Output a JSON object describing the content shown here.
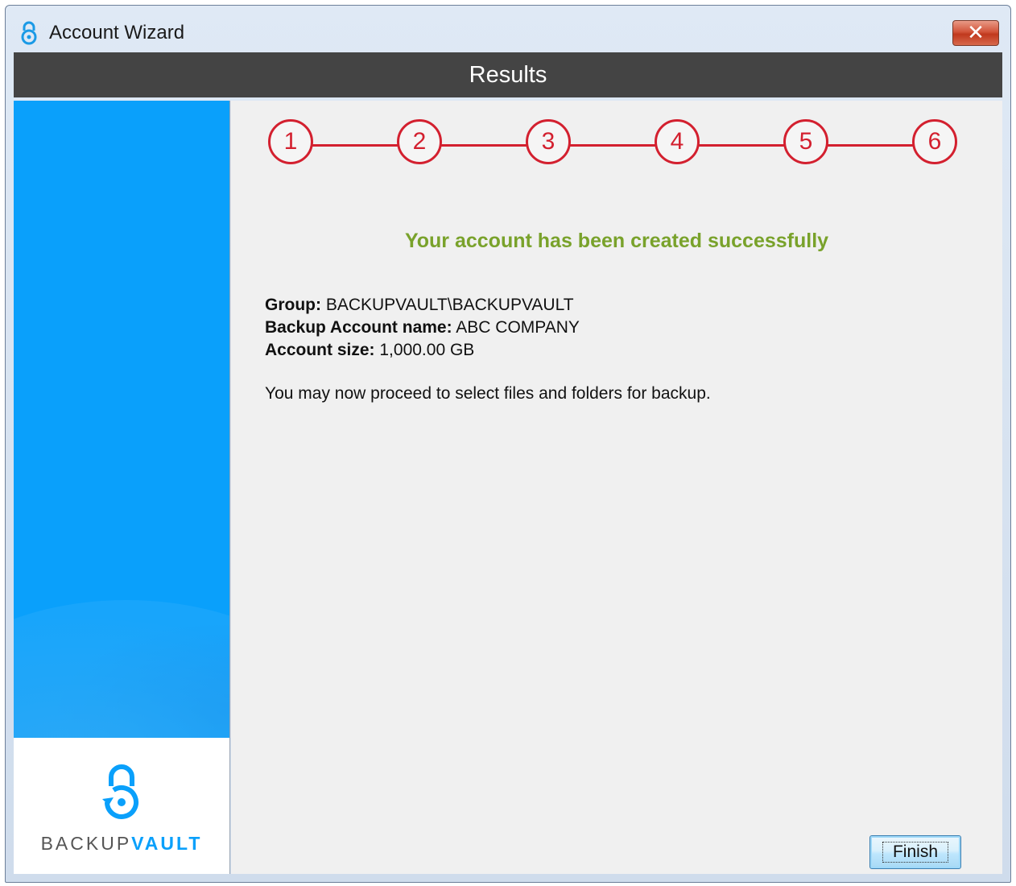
{
  "window": {
    "title": "Account Wizard",
    "close_label": "✕"
  },
  "header": {
    "title": "Results"
  },
  "steps": [
    "1",
    "2",
    "3",
    "4",
    "5",
    "6"
  ],
  "content": {
    "success_message": "Your account has been created successfully",
    "group_label": "Group:",
    "group_value": "BACKUPVAULT\\BACKUPVAULT",
    "account_name_label": "Backup Account name:",
    "account_name_value": "ABC COMPANY",
    "account_size_label": "Account size:",
    "account_size_value": "1,000.00 GB",
    "proceed_text": "You may now proceed to select files and folders for backup."
  },
  "sidebar": {
    "brand_part1": "BACKUP",
    "brand_part2": "VAULT"
  },
  "buttons": {
    "finish": "Finish"
  },
  "colors": {
    "accent_red": "#d3202f",
    "success_green": "#79a22b",
    "brand_blue": "#0aa0fb",
    "header_dark": "#444444"
  },
  "icons": {
    "title_icon": "padlock-icon",
    "logo_icon": "padlock-icon"
  }
}
